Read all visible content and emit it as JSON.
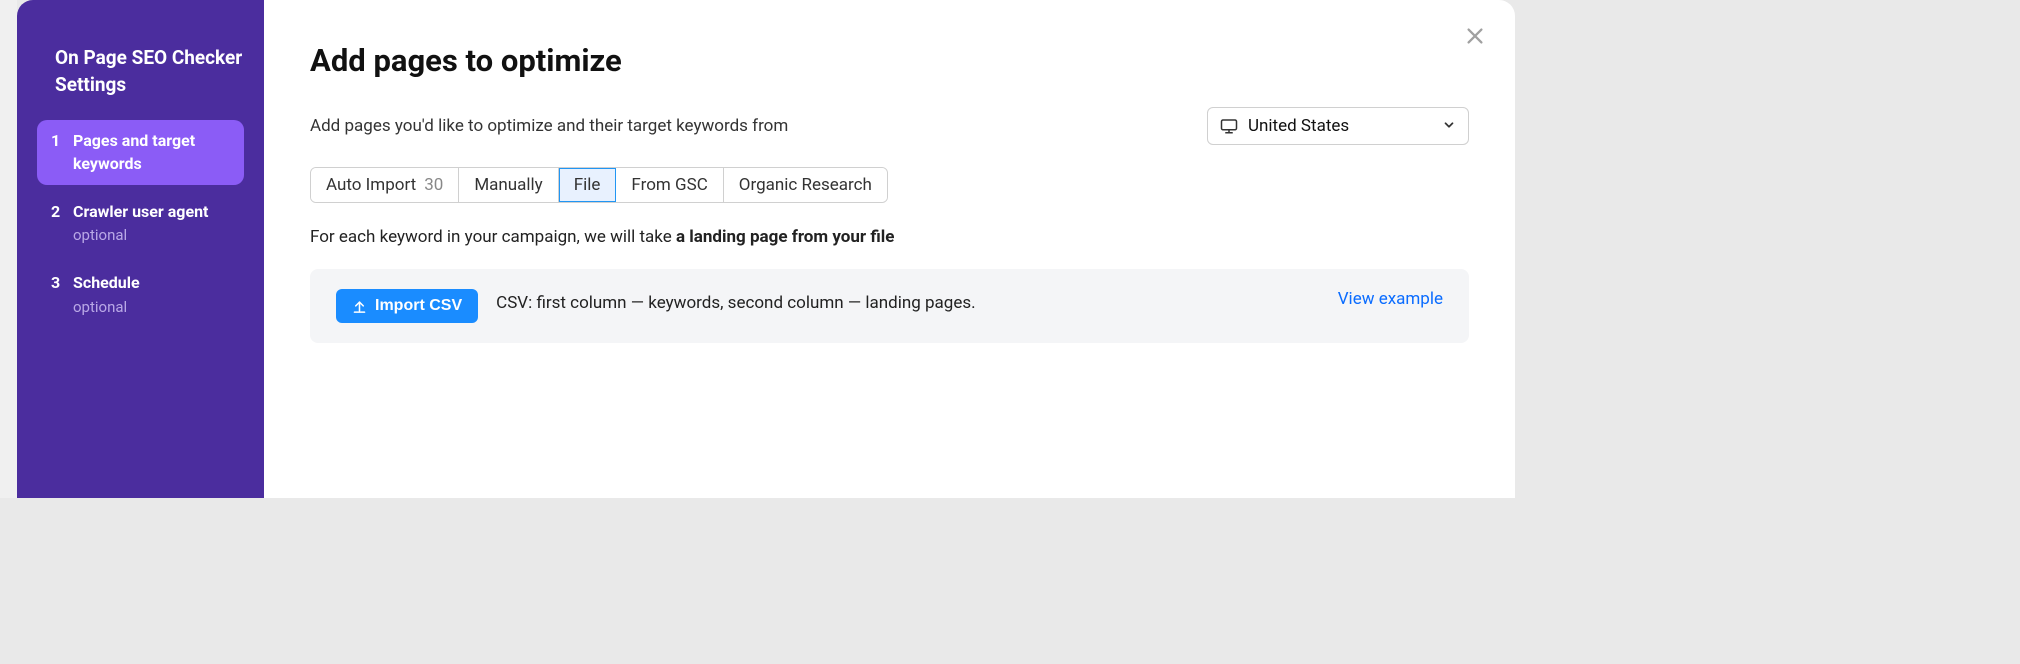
{
  "sidebar": {
    "title": "On Page SEO Checker Settings",
    "steps": [
      {
        "number": "1",
        "label": "Pages and target keywords",
        "sub": ""
      },
      {
        "number": "2",
        "label": "Crawler user agent",
        "sub": "optional"
      },
      {
        "number": "3",
        "label": "Schedule",
        "sub": "optional"
      }
    ]
  },
  "main": {
    "title": "Add pages to optimize",
    "intro_text": "Add pages you'd like to optimize and their target keywords from",
    "country": "United States",
    "tabs": {
      "auto_import_label": "Auto Import",
      "auto_import_count": "30",
      "manually": "Manually",
      "file": "File",
      "from_gsc": "From GSC",
      "organic_research": "Organic Research"
    },
    "desc_prefix": "For each keyword in your campaign, we will take ",
    "desc_bold": "a landing page from your file",
    "import_button": "Import CSV",
    "csv_desc": "CSV: first column — keywords, second column — landing pages.",
    "view_example": "View example"
  }
}
